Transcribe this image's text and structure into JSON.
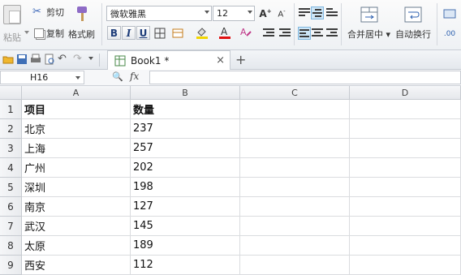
{
  "ribbon": {
    "paste_label": "粘贴",
    "cut_label": "剪切",
    "copy_label": "复制",
    "format_painter_label": "格式刷",
    "font_name": "微软雅黑",
    "font_size": "12",
    "merge_center_label": "合并居中",
    "wrap_text_label": "自动换行",
    "bold_label": "B",
    "italic_label": "I",
    "underline_label": "U",
    "increase_font_label": "A+",
    "decrease_font_label": "A-"
  },
  "tabs": {
    "document_tab": "Book1 *",
    "close_glyph": "×",
    "new_tab_glyph": "+"
  },
  "formula_bar": {
    "name_box": "H16",
    "fx_label": "fx",
    "formula": ""
  },
  "sheet": {
    "columns": [
      "A",
      "B",
      "C",
      "D"
    ],
    "rows": [
      {
        "num": "1",
        "a": "项目",
        "b": "数量"
      },
      {
        "num": "2",
        "a": "北京",
        "b": "237"
      },
      {
        "num": "3",
        "a": "上海",
        "b": "257"
      },
      {
        "num": "4",
        "a": "广州",
        "b": "202"
      },
      {
        "num": "5",
        "a": "深圳",
        "b": "198"
      },
      {
        "num": "6",
        "a": "南京",
        "b": "127"
      },
      {
        "num": "7",
        "a": "武汉",
        "b": "145"
      },
      {
        "num": "8",
        "a": "太原",
        "b": "189"
      },
      {
        "num": "9",
        "a": "西安",
        "b": "112"
      }
    ]
  },
  "colors": {
    "accent": "#3a66b8",
    "font_color_bar": "#e01010",
    "highlight_bar": "#f2d600"
  }
}
